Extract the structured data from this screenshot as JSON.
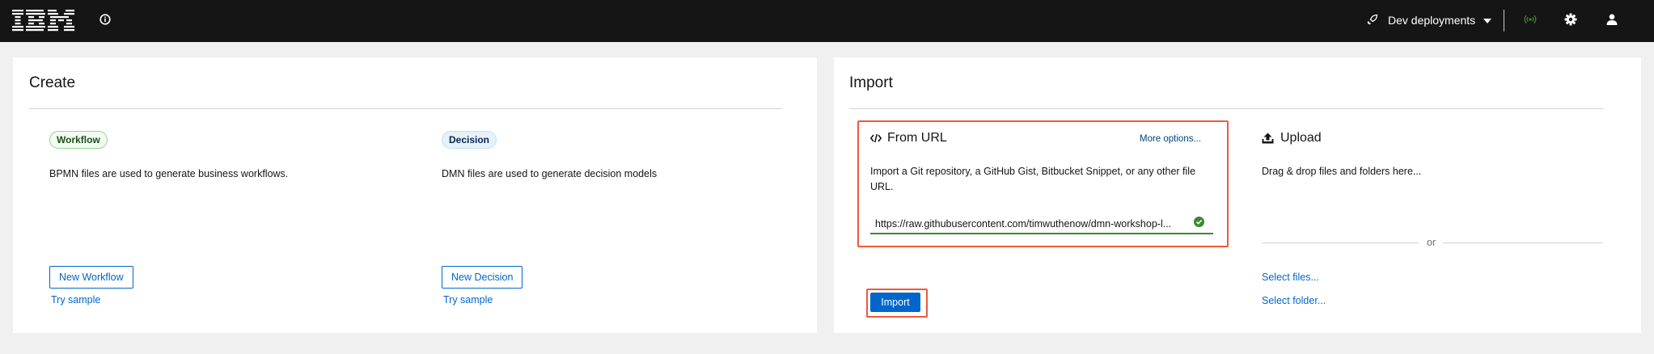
{
  "header": {
    "brand": "IBM",
    "deployments_label": "Dev deployments"
  },
  "create": {
    "title": "Create",
    "workflow": {
      "badge": "Workflow",
      "description": "BPMN files are used to generate business workflows.",
      "button": "New Workflow",
      "sample_link": "Try sample"
    },
    "decision": {
      "badge": "Decision",
      "description": "DMN files are used to generate decision models",
      "button": "New Decision",
      "sample_link": "Try sample"
    }
  },
  "import": {
    "title": "Import",
    "from_url": {
      "title": "From URL",
      "more_options": "More options...",
      "description_line1": "Import a Git repository, a GitHub Gist, Bitbucket Snippet, or any other file",
      "description_line2": "URL.",
      "url_value": "https://raw.githubusercontent.com/timwuthenow/dmn-workshop-l...",
      "import_button": "Import"
    },
    "upload": {
      "title": "Upload",
      "description": "Drag & drop files and folders here...",
      "or": "or",
      "select_files": "Select files...",
      "select_folder": "Select folder..."
    }
  },
  "colors": {
    "header_bg": "#151515",
    "page_bg": "#f0f0f0",
    "primary": "#0066cc",
    "success": "#3e8635",
    "highlight": "#ee5a3c"
  }
}
